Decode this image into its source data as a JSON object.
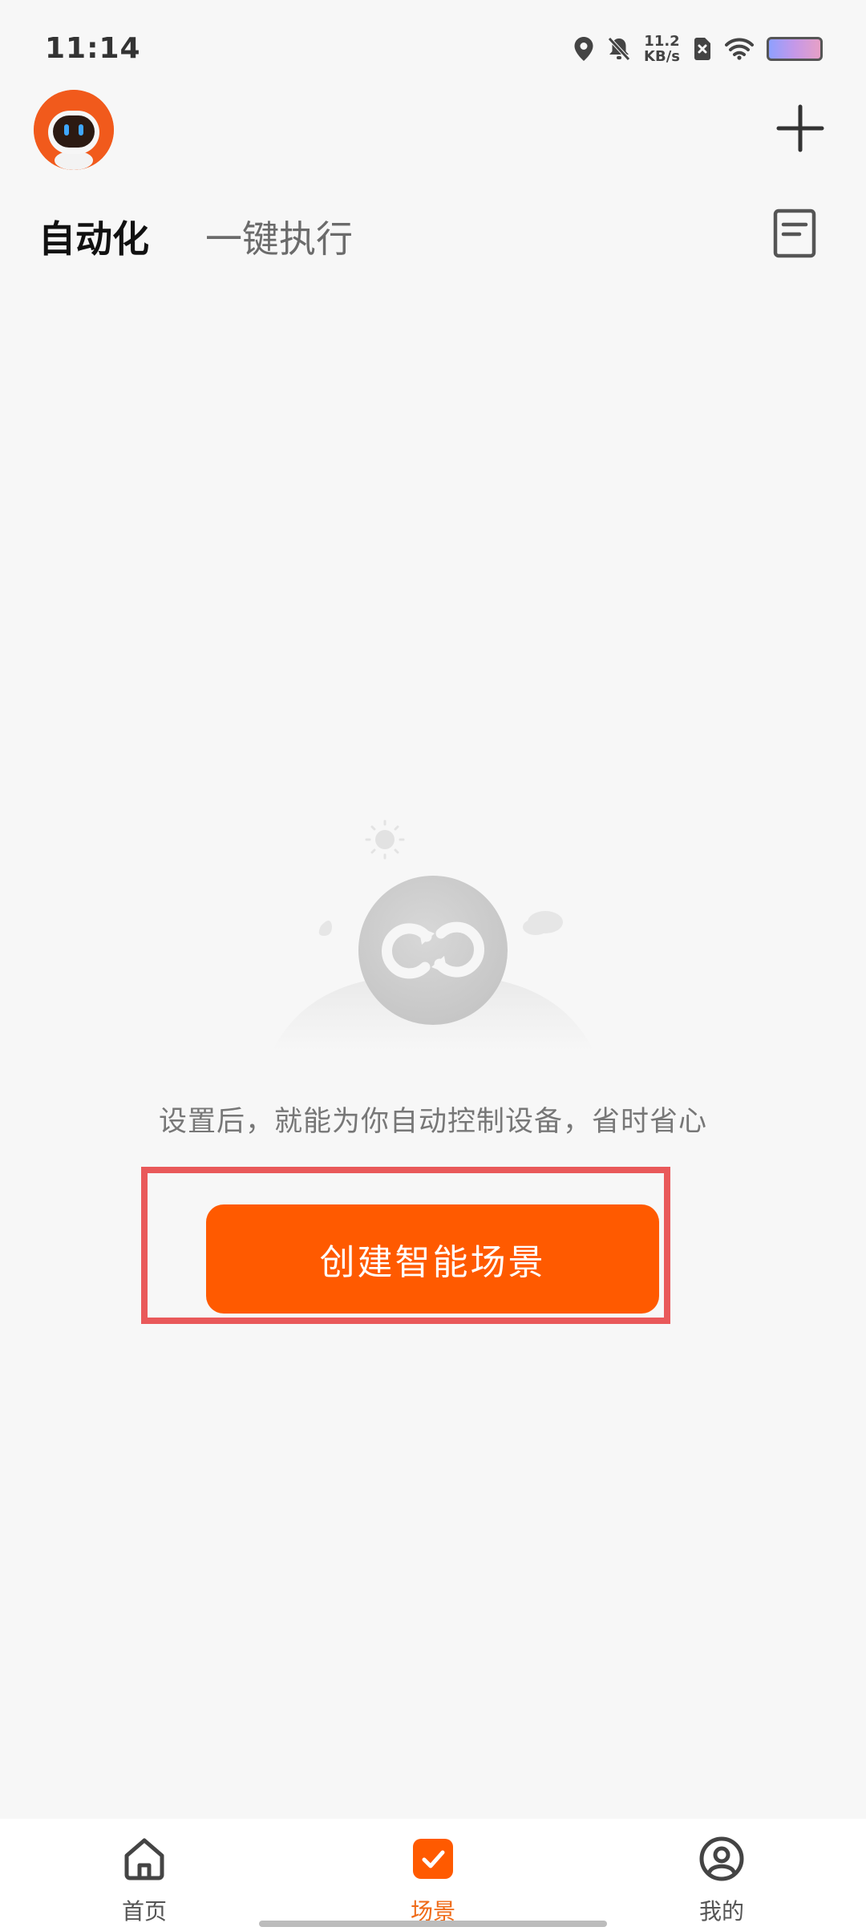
{
  "status_bar": {
    "time": "11:14",
    "net_speed_value": "11.2",
    "net_speed_unit": "KB/s",
    "icons": [
      "location-icon",
      "mute-bell-icon",
      "no-sim-icon",
      "wifi-icon",
      "battery-icon"
    ]
  },
  "header": {
    "avatar_icon": "robot-avatar-icon",
    "add_icon": "plus-icon",
    "log_icon": "document-log-icon"
  },
  "tabs": [
    {
      "label": "自动化",
      "active": true
    },
    {
      "label": "一键执行",
      "active": false
    }
  ],
  "empty_state": {
    "illustration_icon": "cycle-sync-icon",
    "message": "设置后，就能为你自动控制设备，省时省心",
    "button_label": "创建智能场景"
  },
  "bottom_nav": {
    "items": [
      {
        "label": "首页",
        "icon": "home-icon",
        "active": false
      },
      {
        "label": "场景",
        "icon": "scene-check-icon",
        "active": true
      },
      {
        "label": "我的",
        "icon": "profile-icon",
        "active": false
      }
    ]
  },
  "colors": {
    "accent": "#ff5a00",
    "highlight_border": "#e9595a",
    "background": "#f7f7f7",
    "nav_active": "#ef6a17"
  }
}
